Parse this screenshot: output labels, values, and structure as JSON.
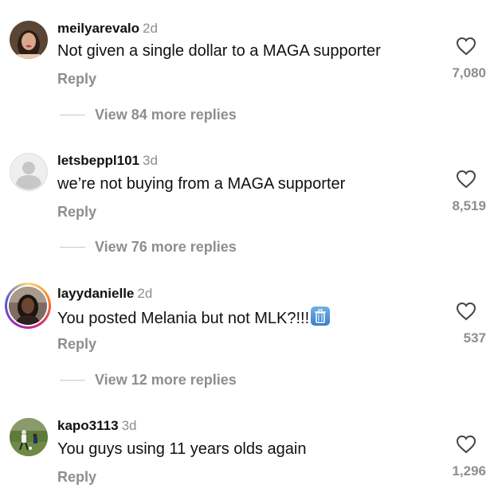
{
  "comments": [
    {
      "username": "meilyarevalo",
      "time": "2d",
      "text": "Not given a single dollar to a MAGA supporter",
      "reply_label": "Reply",
      "likes": "7,080",
      "more_replies": "View 84 more replies",
      "avatar": "photo"
    },
    {
      "username": "letsbeppl101",
      "time": "3d",
      "text": "we’re not buying from a MAGA supporter",
      "reply_label": "Reply",
      "likes": "8,519",
      "more_replies": "View 76 more replies",
      "avatar": "default-user"
    },
    {
      "username": "layydanielle",
      "time": "2d",
      "text": "You posted Melania but not MLK?!!!",
      "emoji": "wastebasket-emoji",
      "reply_label": "Reply",
      "likes": "537",
      "more_replies": "View 12 more replies",
      "avatar": "photo-with-story-ring"
    },
    {
      "username": "kapo3113",
      "time": "3d",
      "text": "You guys using 11 years olds again",
      "reply_label": "Reply",
      "likes": "1,296",
      "avatar": "photo"
    }
  ],
  "icons": {
    "like": "heart-outline-icon"
  },
  "colors": {
    "secondary_text": "#8e8e8e",
    "primary_text": "#111111"
  }
}
